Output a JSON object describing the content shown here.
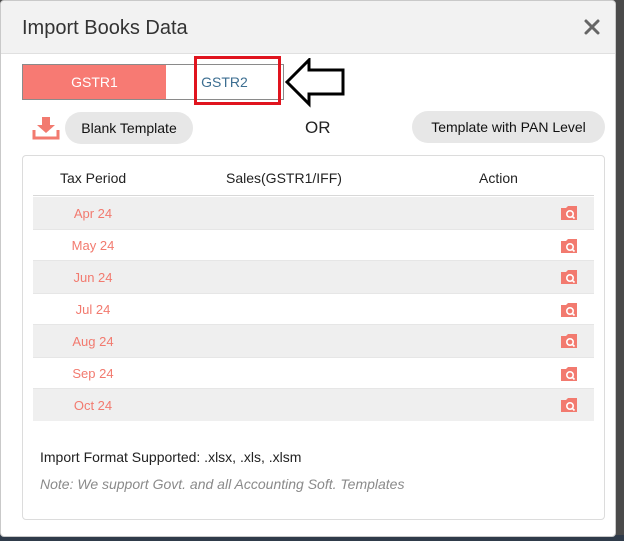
{
  "modal": {
    "title": "Import Books Data"
  },
  "tabs": [
    {
      "label": "GSTR1",
      "active": true
    },
    {
      "label": "GSTR2",
      "active": false
    }
  ],
  "actions": {
    "blank_template": "Blank Template",
    "or": "OR",
    "pan_template": "Template with PAN Level"
  },
  "table": {
    "headers": {
      "period": "Tax Period",
      "sales": "Sales(GSTR1/IFF)",
      "action": "Action"
    },
    "rows": [
      {
        "period": "Apr 24"
      },
      {
        "period": "May 24"
      },
      {
        "period": "Jun 24"
      },
      {
        "period": "Jul 24"
      },
      {
        "period": "Aug 24"
      },
      {
        "period": "Sep 24"
      },
      {
        "period": "Oct 24"
      }
    ]
  },
  "footer": {
    "format": "Import Format Supported: .xlsx, .xls, .xlsm",
    "note": "Note: We support Govt. and all Accounting Soft. Templates"
  },
  "colors": {
    "accent": "#f77a73",
    "tab_inactive_text": "#3c6e91",
    "highlight": "#e0141e"
  },
  "icons": {
    "close": "close-icon",
    "download": "download-icon",
    "row_action": "upload-search-icon"
  }
}
